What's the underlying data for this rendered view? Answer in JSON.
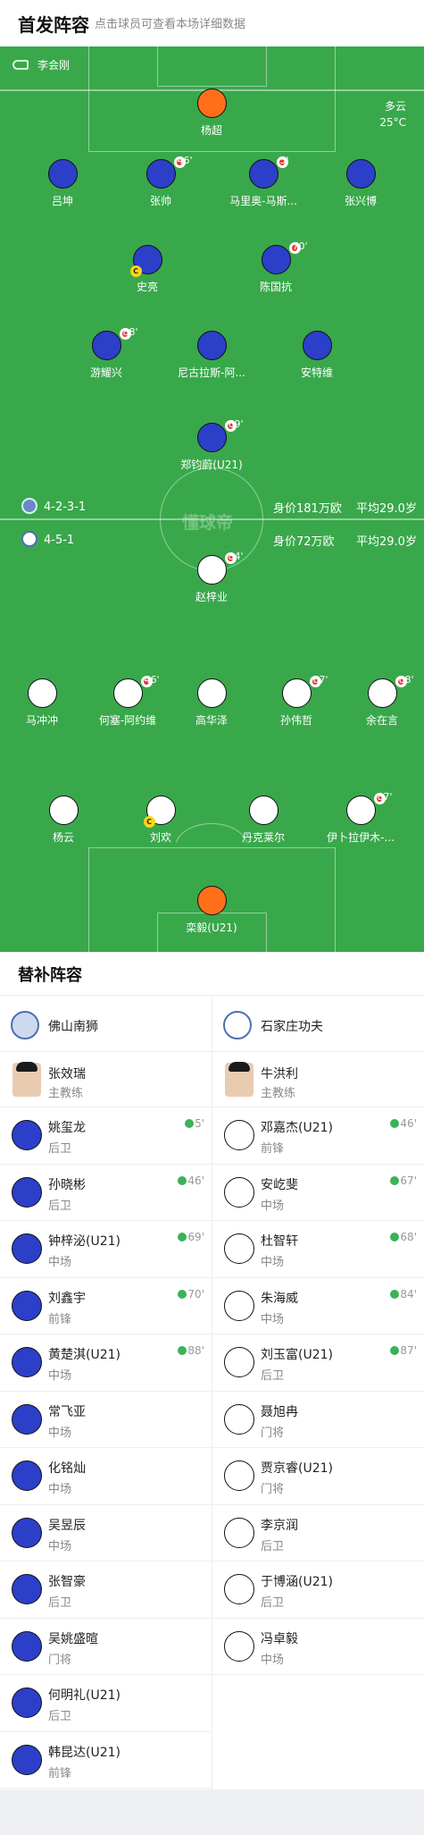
{
  "header": {
    "title": "首发阵容",
    "subtitle": "点击球员可查看本场详细数据"
  },
  "pitch": {
    "referee_icon": "whistle-icon",
    "referee": "李会刚",
    "weather": "多云",
    "temperature": "25°C",
    "watermark": "懂球帝",
    "home": {
      "formation": "4-2-3-1",
      "value": "身价181万欧",
      "age": "平均29.0岁"
    },
    "away": {
      "formation": "4-5-1",
      "value": "身价72万欧",
      "age": "平均29.0岁"
    }
  },
  "home_players": [
    {
      "name": "杨超",
      "color": "orange"
    },
    {
      "name": "吕坤",
      "color": "blue"
    },
    {
      "name": "张帅",
      "color": "blue",
      "sub": "46'"
    },
    {
      "name": "马里奥-马斯...",
      "color": "blue",
      "sub": "5'"
    },
    {
      "name": "张兴博",
      "color": "blue"
    },
    {
      "name": "史亮",
      "color": "blue",
      "captain": "C"
    },
    {
      "name": "陈国抗",
      "color": "blue",
      "sub": "70'"
    },
    {
      "name": "游耀兴",
      "color": "blue",
      "sub": "88'"
    },
    {
      "name": "尼古拉斯-阿...",
      "color": "blue"
    },
    {
      "name": "安特维",
      "color": "blue"
    },
    {
      "name": "郑钧蔚(U21)",
      "color": "blue",
      "sub": "69'"
    }
  ],
  "away_players": [
    {
      "name": "赵梓业",
      "color": "white",
      "sub": "84'"
    },
    {
      "name": "马冲冲",
      "color": "white"
    },
    {
      "name": "何塞-阿约维",
      "color": "white",
      "sub": "46'"
    },
    {
      "name": "高华泽",
      "color": "white"
    },
    {
      "name": "孙伟哲",
      "color": "white",
      "sub": "67'"
    },
    {
      "name": "余在言",
      "color": "white",
      "sub": "68'"
    },
    {
      "name": "杨云",
      "color": "white"
    },
    {
      "name": "刘欢",
      "color": "white",
      "captain": "C"
    },
    {
      "name": "丹克莱尔",
      "color": "white"
    },
    {
      "name": "伊卜拉伊木-...",
      "color": "white",
      "sub": "87'"
    },
    {
      "name": "栾毅(U21)",
      "color": "orange"
    }
  ],
  "subs": {
    "title": "替补阵容",
    "home": {
      "team": "佛山南狮",
      "coach": "张效瑞",
      "coach_role": "主教练",
      "players": [
        {
          "name": "姚玺龙",
          "pos": "后卫",
          "in": "5'",
          "color": "blue"
        },
        {
          "name": "孙晓彬",
          "pos": "后卫",
          "in": "46'",
          "color": "blue"
        },
        {
          "name": "钟梓泌(U21)",
          "pos": "中场",
          "in": "69'",
          "color": "blue"
        },
        {
          "name": "刘鑫宇",
          "pos": "前锋",
          "in": "70'",
          "color": "blue"
        },
        {
          "name": "黄楚淇(U21)",
          "pos": "中场",
          "in": "88'",
          "color": "blue"
        },
        {
          "name": "常飞亚",
          "pos": "中场",
          "color": "blue"
        },
        {
          "name": "化铭灿",
          "pos": "中场",
          "color": "blue"
        },
        {
          "name": "吴昱辰",
          "pos": "中场",
          "color": "blue"
        },
        {
          "name": "张智豪",
          "pos": "后卫",
          "color": "blue"
        },
        {
          "name": "吴姚盛暄",
          "pos": "门将",
          "color": "blue"
        },
        {
          "name": "何明礼(U21)",
          "pos": "后卫",
          "color": "blue"
        },
        {
          "name": "韩昆达(U21)",
          "pos": "前锋",
          "color": "blue"
        }
      ]
    },
    "away": {
      "team": "石家庄功夫",
      "coach": "牛洪利",
      "coach_role": "主教练",
      "players": [
        {
          "name": "邓嘉杰(U21)",
          "pos": "前锋",
          "in": "46'",
          "color": "white"
        },
        {
          "name": "安屹斐",
          "pos": "中场",
          "in": "67'",
          "color": "white"
        },
        {
          "name": "杜智轩",
          "pos": "中场",
          "in": "68'",
          "color": "white"
        },
        {
          "name": "朱海威",
          "pos": "中场",
          "in": "84'",
          "color": "white"
        },
        {
          "name": "刘玉富(U21)",
          "pos": "后卫",
          "in": "87'",
          "color": "white"
        },
        {
          "name": "聂旭冉",
          "pos": "门将",
          "color": "white"
        },
        {
          "name": "贾京睿(U21)",
          "pos": "门将",
          "color": "white"
        },
        {
          "name": "李京润",
          "pos": "后卫",
          "color": "white"
        },
        {
          "name": "于博涵(U21)",
          "pos": "后卫",
          "color": "white"
        },
        {
          "name": "冯卓毅",
          "pos": "中场",
          "color": "white"
        }
      ]
    }
  }
}
